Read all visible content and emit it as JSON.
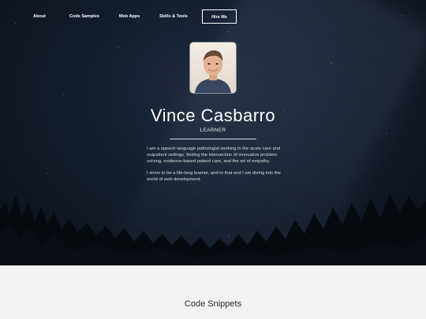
{
  "nav": {
    "items": [
      {
        "label": "About"
      },
      {
        "label": "Code Samples"
      },
      {
        "label": "Web Apps"
      },
      {
        "label": "Skills & Tools"
      },
      {
        "label": "Hire Me"
      }
    ]
  },
  "hero": {
    "name": "Vince Casbarro",
    "subtitle": "LEARNER",
    "bio_1": "I am a speech-language pathologist working in the acute care and outpatient settings, finding the intersection of innovative problem solving, evidence-based patient care, and the art of empathy.",
    "bio_2": "I strive to be a life-long learner, and to that end I am diving into the world of web development."
  },
  "section": {
    "title": "Code Snippets"
  },
  "colors": {
    "hero_bg": "#141d2b",
    "section_bg": "#f2f2f2",
    "text_light": "#ffffff"
  }
}
